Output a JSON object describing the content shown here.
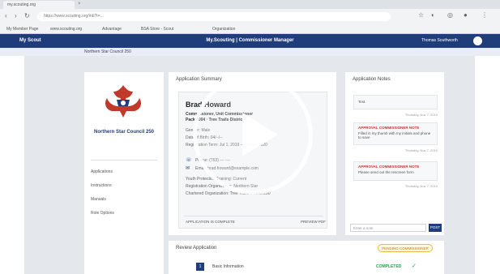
{
  "browser": {
    "tab_title": "my.scouting.org",
    "url": "https://www.scouting.org/mb?t=...",
    "bookmarks": [
      "My Member Page",
      "www.scouting.org",
      "Advantage",
      "BSA Store - Scout",
      "Organization"
    ]
  },
  "app": {
    "brand": "My Scout",
    "title": "My.Scouting | Commissioner Manager",
    "user": "Thomas Southworth",
    "breadcrumb": "Northern Star Council 250"
  },
  "sidebar": {
    "council": "Northern Star Council 250",
    "items": [
      "Applications",
      "Instructions",
      "Manuals",
      "Role Options"
    ]
  },
  "summary": {
    "header": "Application Summary",
    "name": "Brad Howard",
    "subtitle": "Commissioner, Unit Commissioner",
    "unit": "Pack 4004 · Tree Trails District",
    "details": [
      "Gender: Male",
      "Date of Birth: 04/--/--",
      "Registration Term: Jul 1, 2019 – Jun 30, 2020"
    ],
    "phone": "Phone: (763) --- ----",
    "email": "Email: brad.howard@example.com",
    "lines": [
      "Youth Protection Training: Current",
      "Registration Organization: Northern Star",
      "Chartered Organization: Tree Trails District 250"
    ],
    "footer_left": "APPLICATION IS COMPLETE",
    "footer_right": "PREVIEW PDF"
  },
  "notes": {
    "header": "Application Notes",
    "items": [
      {
        "title": "",
        "msg": "Test",
        "date": "Thursday, Nov 7, 2019"
      },
      {
        "title": "APPROVAL COMMISSIONER NOTE",
        "msg": "Filled in my thumb with my initials and phone to save",
        "date": "Thursday, Nov 7, 2019"
      },
      {
        "title": "APPROVAL COMMISSIONER NOTE",
        "msg": "Please send out the rescreen form",
        "date": "Thursday, Nov 7, 2019"
      }
    ],
    "input_placeholder": "Enter a note",
    "post_label": "POST"
  },
  "review": {
    "header": "Review Application",
    "badge": "PENDING COMMISSIONER",
    "step_num": "1",
    "step_label": "Basic Information",
    "step_status": "COMPLETED"
  }
}
